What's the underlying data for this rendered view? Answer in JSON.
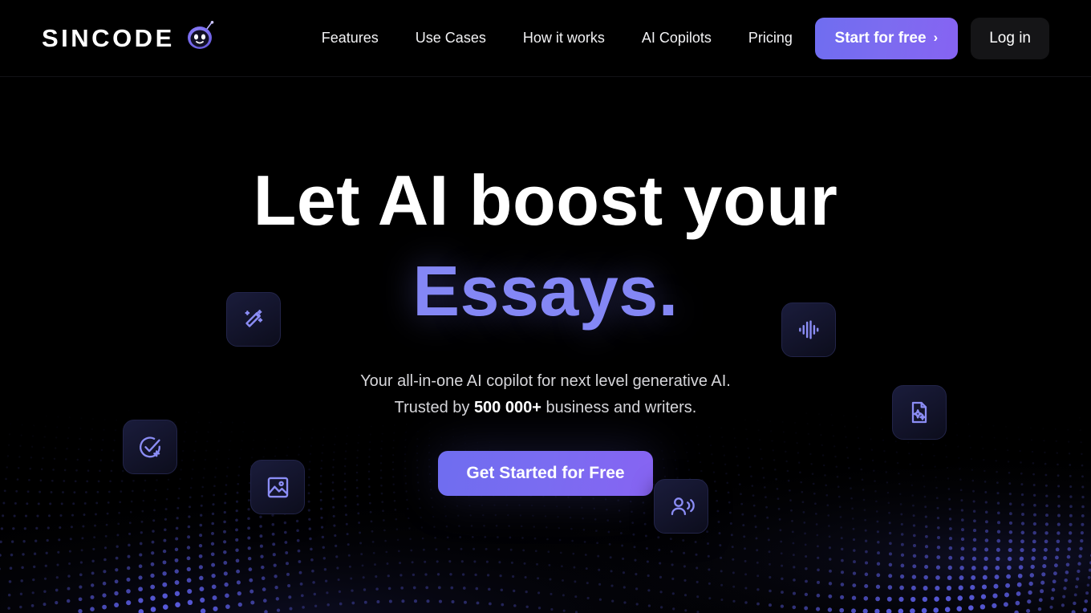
{
  "brand": {
    "name": "SINCODE",
    "mascot_icon": "robot-mascot-icon"
  },
  "nav": {
    "items": [
      {
        "label": "Features"
      },
      {
        "label": "Use Cases"
      },
      {
        "label": "How it works"
      },
      {
        "label": "AI Copilots"
      },
      {
        "label": "Pricing"
      }
    ]
  },
  "header_actions": {
    "start_label": "Start for free",
    "start_chevron": "›",
    "login_label": "Log in"
  },
  "hero": {
    "headline_line1": "Let AI boost your",
    "headline_line2": "Essays.",
    "subtitle_line1": "Your all-in-one AI copilot for next level generative AI.",
    "subtitle_line2_prefix": "Trusted by ",
    "subtitle_line2_strong": "500 000+",
    "subtitle_line2_suffix": " business and writers.",
    "cta_label": "Get Started for Free"
  },
  "floating_tiles": [
    {
      "icon": "magic-wand-icon",
      "label": "Magic wand"
    },
    {
      "icon": "audio-wave-icon",
      "label": "Audio waveform"
    },
    {
      "icon": "document-sparkle-icon",
      "label": "AI document"
    },
    {
      "icon": "check-circle-plus-icon",
      "label": "Add task"
    },
    {
      "icon": "image-icon",
      "label": "AI image"
    },
    {
      "icon": "person-voice-icon",
      "label": "AI voice"
    }
  ],
  "colors": {
    "background": "#000000",
    "accent": "#8487f5",
    "accent_gradient_start": "#6f6df0",
    "accent_gradient_end": "#8764f2",
    "text_primary": "#ffffff",
    "text_secondary": "#d6d6da",
    "tile_background": "#16182f",
    "dot_wave": "#5a5ce0"
  }
}
